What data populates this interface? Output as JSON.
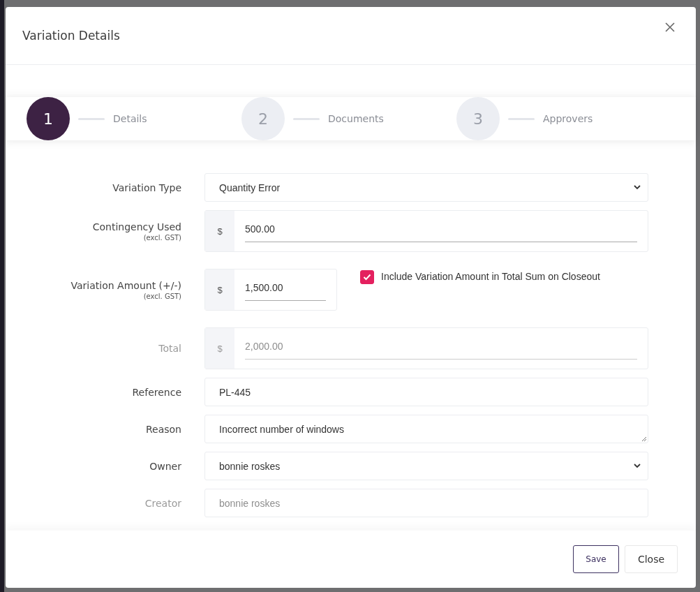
{
  "dialog": {
    "title": "Variation Details",
    "steps": [
      {
        "number": "1",
        "label": "Details",
        "selected": true
      },
      {
        "number": "2",
        "label": "Documents",
        "selected": false
      },
      {
        "number": "3",
        "label": "Approvers",
        "selected": false
      }
    ],
    "fields": [
      {
        "kind": "select",
        "label": "Variation Type",
        "value": "Quantity Error",
        "disabled": false
      },
      {
        "kind": "currency",
        "label": "Contingency Used",
        "note": "(excl. GST)",
        "prefix": "$",
        "value": "500.00",
        "disabled": false
      },
      {
        "kind": "currency",
        "label": "Variation Amount (+/-)",
        "note": "(excl. GST)",
        "prefix": "$",
        "value": "1,500.00",
        "disabled": false,
        "checkbox": {
          "label": "Include Variation Amount in Total Sum on Closeout",
          "checked": true
        }
      },
      {
        "kind": "currency",
        "label": "Total",
        "prefix": "$",
        "value": "2,000.00",
        "disabled": true
      },
      {
        "kind": "text",
        "label": "Reference",
        "value": "PL-445",
        "disabled": false
      },
      {
        "kind": "textarea",
        "label": "Reason",
        "value": "Incorrect number of windows",
        "disabled": false
      },
      {
        "kind": "select",
        "label": "Owner",
        "value": "bonnie roskes",
        "disabled": false
      },
      {
        "kind": "text",
        "label": "Creator",
        "value": "bonnie roskes",
        "disabled": true
      }
    ],
    "buttons": [
      {
        "label": "Save",
        "kind": "primary"
      },
      {
        "label": "Close",
        "kind": "secondary"
      }
    ]
  }
}
